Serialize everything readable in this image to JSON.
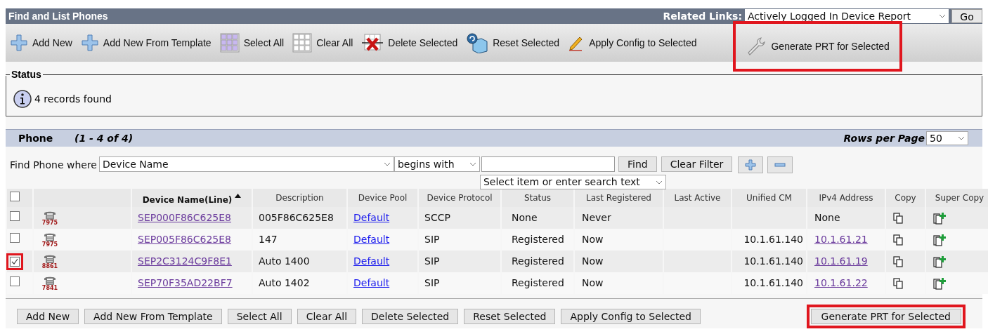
{
  "window": {
    "title": "Find and List Phones"
  },
  "related_links": {
    "label": "Related Links:",
    "value": "Actively Logged In Device Report",
    "button": "Go"
  },
  "toolbar": [
    {
      "kind": "add",
      "label": "Add New",
      "highlighted": false
    },
    {
      "kind": "add",
      "label": "Add New From Template",
      "highlighted": false
    },
    {
      "kind": "select_all",
      "label": "Select All",
      "highlighted": false
    },
    {
      "kind": "clear_all",
      "label": "Clear All",
      "highlighted": false
    },
    {
      "kind": "delete",
      "label": "Delete Selected",
      "highlighted": false
    },
    {
      "kind": "reset",
      "label": "Reset Selected",
      "highlighted": false
    },
    {
      "kind": "apply",
      "label": "Apply Config to Selected",
      "highlighted": false
    },
    {
      "kind": "generate",
      "label": "Generate PRT for Selected",
      "highlighted": true
    }
  ],
  "status": {
    "title": "Status",
    "message": "4 records found"
  },
  "phone_panel": {
    "title": "Phone",
    "range": "(1 - 4 of 4)",
    "rows_per_page_label": "Rows per Page",
    "rows_per_page": "50"
  },
  "filter": {
    "label": "Find Phone where",
    "field": "Device Name",
    "operator": "begins with",
    "suggestion": "Select item or enter search text",
    "buttons": [
      "Find",
      "Clear Filter"
    ]
  },
  "table": {
    "select_all_checked": false,
    "columns": [
      {
        "label": "Device Name(Line)",
        "sorted": true
      },
      {
        "label": "Description",
        "sorted": false
      },
      {
        "label": "Device Pool",
        "sorted": false
      },
      {
        "label": "Device Protocol",
        "sorted": false
      },
      {
        "label": "Status",
        "sorted": false
      },
      {
        "label": "Last Registered",
        "sorted": false
      },
      {
        "label": "Last Active",
        "sorted": false
      },
      {
        "label": "Unified CM",
        "sorted": false
      },
      {
        "label": "IPv4 Address",
        "sorted": false
      },
      {
        "label": "Copy",
        "sorted": false
      },
      {
        "label": "Super Copy",
        "sorted": false
      }
    ],
    "rows": [
      {
        "checked": false,
        "highlighted": false,
        "model": "7975",
        "device_name": "SEP000F86C625E8",
        "description": "005F86C625E8",
        "device_pool": "Default",
        "protocol": "SCCP",
        "status": "None",
        "last_registered": "Never",
        "ipv4": "None",
        "ipv4_link": false
      },
      {
        "checked": false,
        "highlighted": false,
        "model": "7975",
        "device_name": "SEP005F86C625E8",
        "description": "147",
        "device_pool": "Default",
        "protocol": "SIP",
        "status": "Registered",
        "last_registered": "Now",
        "unified_cm": "10.1.61.140",
        "ipv4": "10.1.61.21",
        "ipv4_link": true
      },
      {
        "checked": true,
        "highlighted": true,
        "model": "8861",
        "device_name": "SEP2C3124C9F8E1",
        "description": "Auto 1400",
        "device_pool": "Default",
        "protocol": "SIP",
        "status": "Registered",
        "last_registered": "Now",
        "unified_cm": "10.1.61.140",
        "ipv4": "10.1.61.19",
        "ipv4_link": true
      },
      {
        "checked": false,
        "highlighted": false,
        "model": "7841",
        "device_name": "SEP70F35AD22BF7",
        "description": "Auto 1402",
        "device_pool": "Default",
        "protocol": "SIP",
        "status": "Registered",
        "last_registered": "Now",
        "unified_cm": "10.1.61.140",
        "ipv4": "10.1.61.22",
        "ipv4_link": true
      }
    ]
  },
  "bottom_buttons": [
    {
      "label": "Add New",
      "highlighted": false
    },
    {
      "label": "Add New From Template",
      "highlighted": false
    },
    {
      "label": "Select All",
      "highlighted": false
    },
    {
      "label": "Clear All",
      "highlighted": false
    },
    {
      "label": "Delete Selected",
      "highlighted": false
    },
    {
      "label": "Reset Selected",
      "highlighted": false
    },
    {
      "label": "Apply Config to Selected",
      "highlighted": false
    },
    {
      "label": "Generate PRT for Selected",
      "highlighted": true
    }
  ]
}
